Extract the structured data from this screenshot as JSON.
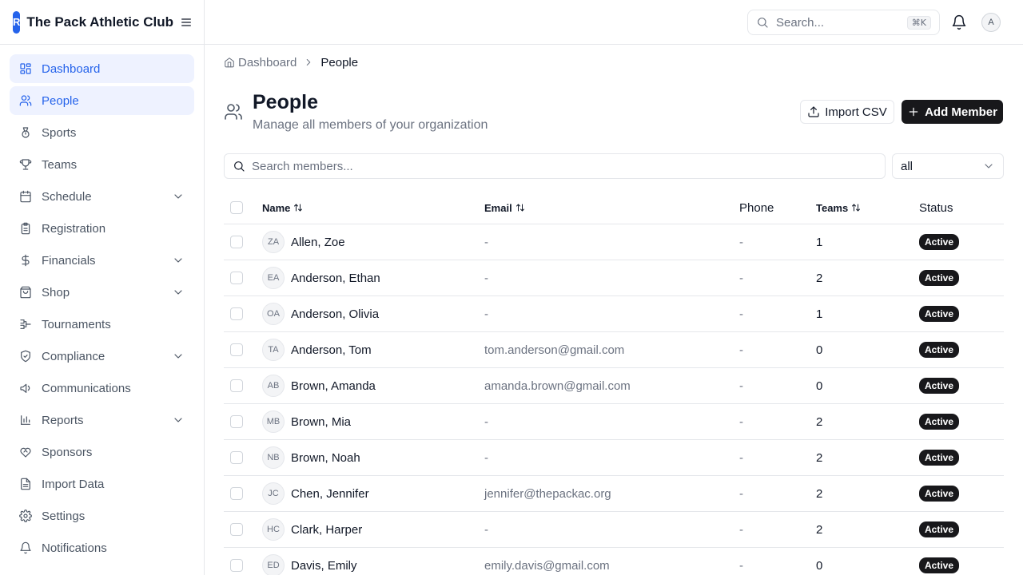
{
  "app": {
    "brand_letter": "R",
    "brand_name": "The Pack Athletic Club",
    "accent_color": "#2563eb"
  },
  "sidebar": {
    "items": [
      {
        "label": "Dashboard",
        "icon": "dashboard-icon",
        "active": true,
        "expandable": false
      },
      {
        "label": "People",
        "icon": "users-icon",
        "active": true,
        "expandable": false
      },
      {
        "label": "Sports",
        "icon": "medal-icon",
        "active": false,
        "expandable": false
      },
      {
        "label": "Teams",
        "icon": "trophy-icon",
        "active": false,
        "expandable": false
      },
      {
        "label": "Schedule",
        "icon": "calendar-icon",
        "active": false,
        "expandable": true
      },
      {
        "label": "Registration",
        "icon": "clipboard-icon",
        "active": false,
        "expandable": false
      },
      {
        "label": "Financials",
        "icon": "dollar-icon",
        "active": false,
        "expandable": true
      },
      {
        "label": "Shop",
        "icon": "shopping-bag-icon",
        "active": false,
        "expandable": true
      },
      {
        "label": "Tournaments",
        "icon": "bracket-icon",
        "active": false,
        "expandable": false
      },
      {
        "label": "Compliance",
        "icon": "shield-check-icon",
        "active": false,
        "expandable": true
      },
      {
        "label": "Communications",
        "icon": "megaphone-icon",
        "active": false,
        "expandable": false
      },
      {
        "label": "Reports",
        "icon": "bar-chart-icon",
        "active": false,
        "expandable": true
      },
      {
        "label": "Sponsors",
        "icon": "handshake-icon",
        "active": false,
        "expandable": false
      },
      {
        "label": "Import Data",
        "icon": "file-spreadsheet-icon",
        "active": false,
        "expandable": false
      },
      {
        "label": "Settings",
        "icon": "gear-icon",
        "active": false,
        "expandable": false
      },
      {
        "label": "Notifications",
        "icon": "bell-icon",
        "active": false,
        "expandable": false
      }
    ]
  },
  "topbar": {
    "search_placeholder": "Search...",
    "shortcut": "⌘K",
    "user_initial": "A"
  },
  "breadcrumb": {
    "home": "Dashboard",
    "current": "People"
  },
  "page": {
    "title": "People",
    "subtitle": "Manage all members of your organization",
    "import_label": "Import CSV",
    "add_label": "Add Member",
    "search_placeholder": "Search members...",
    "status_filter": "all"
  },
  "table": {
    "columns": {
      "name": "Name",
      "email": "Email",
      "phone": "Phone",
      "teams": "Teams",
      "status": "Status"
    },
    "rows": [
      {
        "initials": "ZA",
        "name": "Allen, Zoe",
        "email": "-",
        "phone": "-",
        "teams": "1",
        "status": "Active"
      },
      {
        "initials": "EA",
        "name": "Anderson, Ethan",
        "email": "-",
        "phone": "-",
        "teams": "2",
        "status": "Active"
      },
      {
        "initials": "OA",
        "name": "Anderson, Olivia",
        "email": "-",
        "phone": "-",
        "teams": "1",
        "status": "Active"
      },
      {
        "initials": "TA",
        "name": "Anderson, Tom",
        "email": "tom.anderson@gmail.com",
        "phone": "-",
        "teams": "0",
        "status": "Active"
      },
      {
        "initials": "AB",
        "name": "Brown, Amanda",
        "email": "amanda.brown@gmail.com",
        "phone": "-",
        "teams": "0",
        "status": "Active"
      },
      {
        "initials": "MB",
        "name": "Brown, Mia",
        "email": "-",
        "phone": "-",
        "teams": "2",
        "status": "Active"
      },
      {
        "initials": "NB",
        "name": "Brown, Noah",
        "email": "-",
        "phone": "-",
        "teams": "2",
        "status": "Active"
      },
      {
        "initials": "JC",
        "name": "Chen, Jennifer",
        "email": "jennifer@thepackac.org",
        "phone": "-",
        "teams": "2",
        "status": "Active"
      },
      {
        "initials": "HC",
        "name": "Clark, Harper",
        "email": "-",
        "phone": "-",
        "teams": "2",
        "status": "Active"
      },
      {
        "initials": "ED",
        "name": "Davis, Emily",
        "email": "emily.davis@gmail.com",
        "phone": "-",
        "teams": "0",
        "status": "Active"
      }
    ]
  }
}
